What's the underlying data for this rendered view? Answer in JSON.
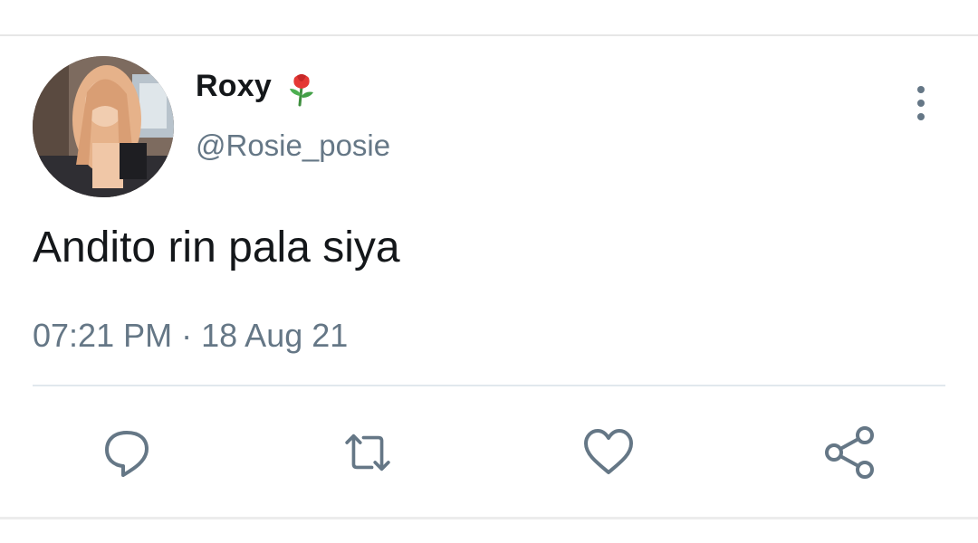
{
  "tweet": {
    "author_name": "Roxy",
    "author_emoji": "rose-icon",
    "handle": "@Rosie_posie",
    "text": "Andito rin pala siya",
    "time": "07:21 PM",
    "separator": "·",
    "date": "18 Aug 21"
  },
  "actions": {
    "reply": "reply-icon",
    "retweet": "retweet-icon",
    "like": "heart-icon",
    "share": "share-icon"
  },
  "colors": {
    "text_primary": "#14171a",
    "text_secondary": "#657786",
    "icon": "#657786",
    "divider": "#e1e8ed"
  }
}
